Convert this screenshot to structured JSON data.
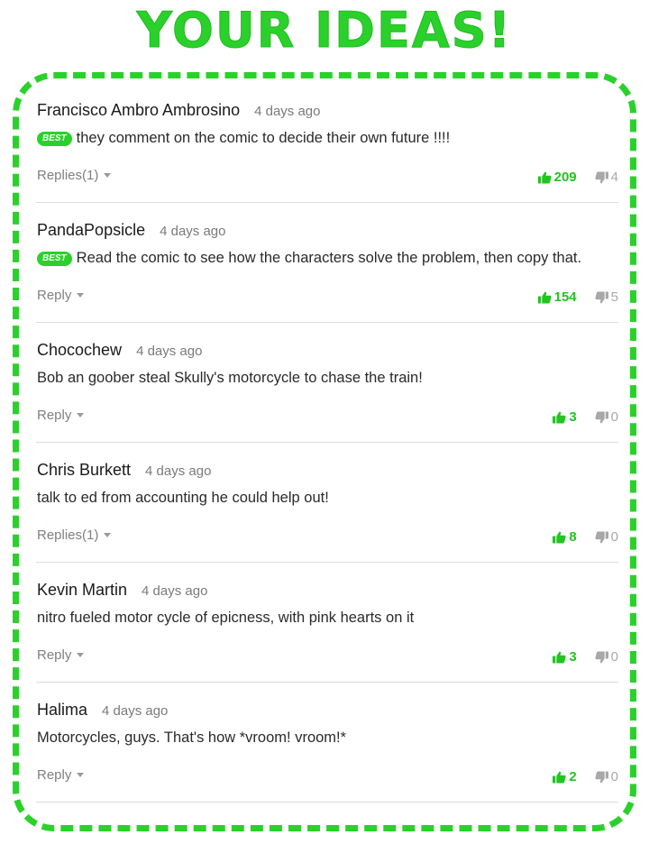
{
  "page": {
    "title": "YOUR IDEAS!",
    "accent_color": "#2bd12b"
  },
  "comments": [
    {
      "author": "Francisco Ambro Ambrosino",
      "time": "4 days ago",
      "badge": "BEST",
      "text": "they comment on the comic to decide their own future !!!!",
      "reply_label": "Replies(1)",
      "upvotes": "209",
      "downvotes": "4"
    },
    {
      "author": "PandaPopsicle",
      "time": "4 days ago",
      "badge": "BEST",
      "text": "Read the comic to see how the characters solve the problem, then copy that.",
      "reply_label": "Reply",
      "upvotes": "154",
      "downvotes": "5"
    },
    {
      "author": "Chocochew",
      "time": "4 days ago",
      "badge": "",
      "text": "Bob an goober steal Skully's motorcycle to chase the train!",
      "reply_label": "Reply",
      "upvotes": "3",
      "downvotes": "0"
    },
    {
      "author": "Chris Burkett",
      "time": "4 days ago",
      "badge": "",
      "text": "talk to ed from accounting he could help out!",
      "reply_label": "Replies(1)",
      "upvotes": "8",
      "downvotes": "0"
    },
    {
      "author": "Kevin Martin",
      "time": "4 days ago",
      "badge": "",
      "text": "nitro fueled motor cycle of epicness, with pink hearts on it",
      "reply_label": "Reply",
      "upvotes": "3",
      "downvotes": "0"
    },
    {
      "author": "Halima",
      "time": "4 days ago",
      "badge": "",
      "text": "Motorcycles, guys. That's how *vroom! vroom!*",
      "reply_label": "Reply",
      "upvotes": "2",
      "downvotes": "0"
    }
  ]
}
